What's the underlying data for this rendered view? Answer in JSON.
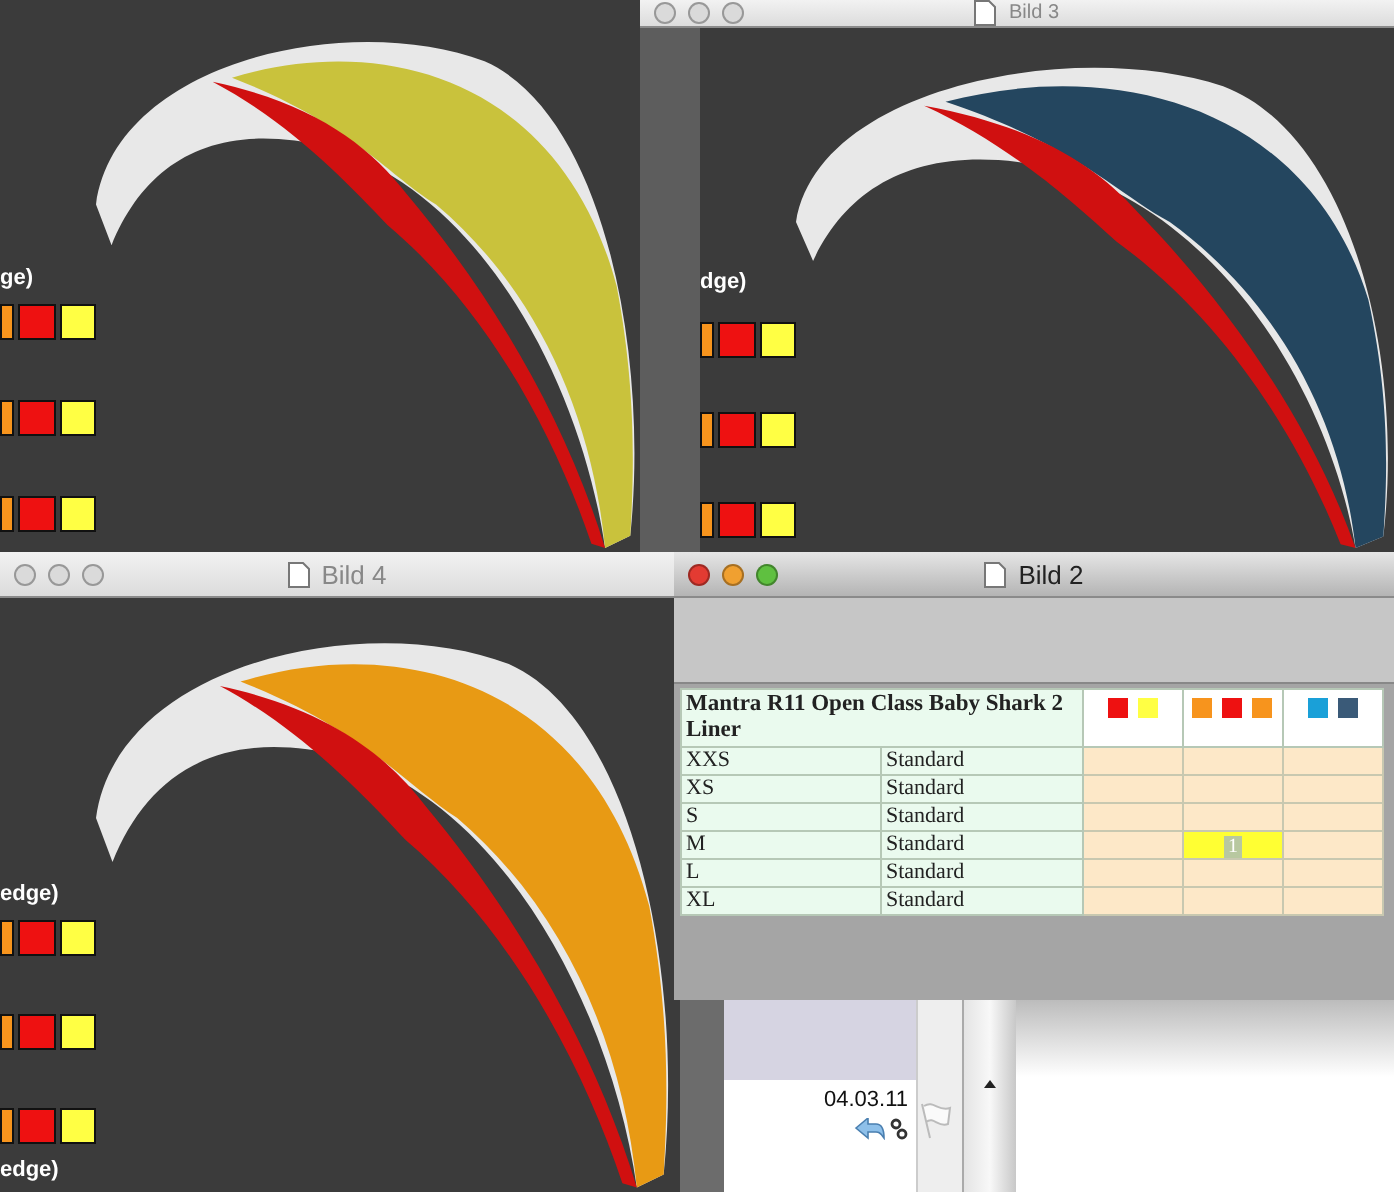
{
  "windows": [
    {
      "kind": "render",
      "color": "#c9c23c",
      "caption_top": "ge)",
      "swatch_rows": [
        {
          "swatches": [
            {
              "color": "#f7941d"
            },
            {
              "color": "#ee1111"
            },
            {
              "color": "#ffff44"
            }
          ]
        },
        {
          "swatches": [
            {
              "color": "#f7941d"
            },
            {
              "color": "#ee1111"
            },
            {
              "color": "#ffff44"
            }
          ]
        },
        {
          "swatches": [
            {
              "color": "#f7941d"
            },
            {
              "color": "#ee1111"
            },
            {
              "color": "#ffff44"
            }
          ]
        }
      ]
    },
    {
      "kind": "render",
      "title": "Bild 3",
      "active": false,
      "color": "#24465f",
      "caption_top": "dge)",
      "swatch_rows": [
        {
          "swatches": [
            {
              "color": "#f7941d"
            },
            {
              "color": "#ee1111"
            },
            {
              "color": "#ffff44"
            }
          ]
        },
        {
          "swatches": [
            {
              "color": "#f7941d"
            },
            {
              "color": "#ee1111"
            },
            {
              "color": "#ffff44"
            }
          ]
        },
        {
          "swatches": [
            {
              "color": "#f7941d"
            },
            {
              "color": "#ee1111"
            },
            {
              "color": "#ffff44"
            }
          ]
        }
      ]
    },
    {
      "kind": "render",
      "title": "Bild 4",
      "active": false,
      "color": "#e89a14",
      "caption_top": "edge)",
      "caption_bottom": "edge)",
      "swatch_rows": [
        {
          "swatches": [
            {
              "color": "#f7941d"
            },
            {
              "color": "#ee1111"
            },
            {
              "color": "#ffff44"
            }
          ]
        },
        {
          "swatches": [
            {
              "color": "#f7941d"
            },
            {
              "color": "#ee1111"
            },
            {
              "color": "#ffff44"
            }
          ]
        },
        {
          "swatches": [
            {
              "color": "#f7941d"
            },
            {
              "color": "#ee1111"
            },
            {
              "color": "#ffff44"
            }
          ]
        }
      ]
    },
    {
      "kind": "table",
      "title": "Bild 2",
      "active": true,
      "table": {
        "heading": "Mantra R11 Open Class Baby Shark 2 Liner",
        "color_columns": [
          {
            "swatches": [
              {
                "color": "#ee1111"
              },
              {
                "color": "#ffff44"
              }
            ]
          },
          {
            "swatches": [
              {
                "color": "#f7941d"
              },
              {
                "color": "#ee1111"
              },
              {
                "color": "#f7941d"
              }
            ]
          },
          {
            "swatches": [
              {
                "color": "#1aa0d8"
              },
              {
                "color": "#3a5a78"
              }
            ]
          }
        ],
        "rows": [
          {
            "size": "XXS",
            "type": "Standard",
            "cells": [
              {
                "highlighted": false
              },
              {
                "highlighted": false
              },
              {
                "highlighted": false
              }
            ]
          },
          {
            "size": "XS",
            "type": "Standard",
            "cells": [
              {
                "highlighted": false
              },
              {
                "highlighted": false
              },
              {
                "highlighted": false
              }
            ]
          },
          {
            "size": "S",
            "type": "Standard",
            "cells": [
              {
                "highlighted": false
              },
              {
                "highlighted": false
              },
              {
                "highlighted": false
              }
            ]
          },
          {
            "size": "M",
            "type": "Standard",
            "cells": [
              {
                "highlighted": false
              },
              {
                "highlighted": true,
                "value": "1"
              },
              {
                "highlighted": false
              }
            ]
          },
          {
            "size": "L",
            "type": "Standard",
            "cells": [
              {
                "highlighted": false
              },
              {
                "highlighted": false
              },
              {
                "highlighted": false
              }
            ]
          },
          {
            "size": "XL",
            "type": "Standard",
            "cells": [
              {
                "highlighted": false
              },
              {
                "highlighted": false
              },
              {
                "highlighted": false
              }
            ]
          }
        ]
      }
    },
    {
      "kind": "mail",
      "date": "04.03.11"
    }
  ]
}
